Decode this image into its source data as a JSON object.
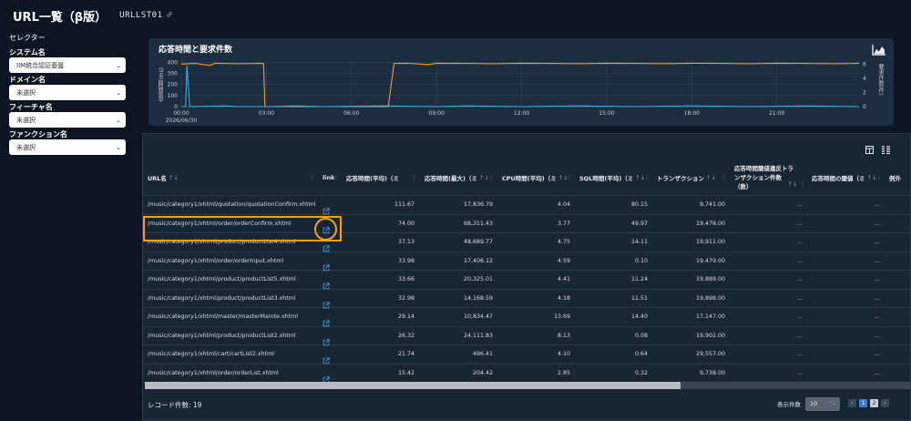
{
  "header": {
    "title": "URL一覧（β版）",
    "code": "URLLST01"
  },
  "sidebar": {
    "heading": "セレクター",
    "fields": [
      {
        "label": "システム名",
        "value": "IIM統合認証基盤"
      },
      {
        "label": "ドメイン名",
        "value": "未選択"
      },
      {
        "label": "フィーチャ名",
        "value": "未選択"
      },
      {
        "label": "ファンクション名",
        "value": "未選択"
      }
    ]
  },
  "chart": {
    "title": "応答時間と要求件数",
    "icon": "area-chart-icon",
    "y_left_title": "応答時間(ms)",
    "y_right_title": "要求件数(件)",
    "x_first_date": "2026/06/30"
  },
  "chart_data": {
    "type": "line",
    "x_ticks": [
      "00:00",
      "03:00",
      "06:00",
      "09:00",
      "12:00",
      "15:00",
      "18:00",
      "21:00"
    ],
    "y_left_ticks": [
      "0",
      "100",
      "200",
      "300",
      "400"
    ],
    "y_right_ticks": [
      "0",
      "2",
      "4",
      "6"
    ],
    "ylim_left": [
      0,
      420
    ],
    "ylim_right": [
      0,
      6.6
    ],
    "xlim_hours": [
      0,
      23.9
    ],
    "grid": true,
    "series": [
      {
        "color": "#f0a030",
        "axis": "left",
        "points": [
          [
            0,
            385
          ],
          [
            0.5,
            390
          ],
          [
            1,
            372
          ],
          [
            1.2,
            392
          ],
          [
            2,
            388
          ],
          [
            2.9,
            390
          ],
          [
            2.95,
            0
          ],
          [
            7.3,
            0
          ],
          [
            7.5,
            390
          ],
          [
            8,
            392
          ],
          [
            8.7,
            380
          ],
          [
            9,
            392
          ],
          [
            10,
            390
          ],
          [
            11,
            388
          ],
          [
            12,
            392
          ],
          [
            13,
            390
          ],
          [
            14,
            388
          ],
          [
            15,
            392
          ],
          [
            16,
            390
          ],
          [
            17,
            388
          ],
          [
            18,
            392
          ],
          [
            19,
            390
          ],
          [
            20,
            388
          ],
          [
            21,
            392
          ],
          [
            22,
            390
          ],
          [
            23,
            388
          ],
          [
            23.9,
            390
          ]
        ]
      },
      {
        "color": "#3fa8e0",
        "axis": "right",
        "points": [
          [
            0,
            0
          ],
          [
            0.15,
            0
          ],
          [
            0.2,
            5.8
          ],
          [
            0.3,
            0
          ],
          [
            1.5,
            0.1
          ],
          [
            2,
            0
          ],
          [
            3,
            0
          ],
          [
            4,
            0.1
          ],
          [
            5,
            0
          ],
          [
            7,
            0.1
          ],
          [
            9,
            0
          ],
          [
            10,
            0.1
          ],
          [
            12,
            0
          ],
          [
            14,
            0.1
          ],
          [
            16,
            0
          ],
          [
            18,
            0.1
          ],
          [
            20,
            0
          ],
          [
            22,
            0.1
          ],
          [
            23.9,
            0
          ]
        ]
      }
    ]
  },
  "table": {
    "columns": [
      "URL名",
      "link",
      "応答時間(平均)（ミ",
      "応答時間(最大)（ミ",
      "CPU時間(平均)（ミ",
      "SQL時間(平均)（ミ",
      "トランザクション",
      "応答時間閾値違反トランザクション件数（数）",
      "応答時間の閾値（ミ",
      "例外"
    ],
    "rows": [
      {
        "url": "/music/category1/xhtml/quotation/quotationConfirm.xhtml",
        "avg": "111.67",
        "max": "17,836.79",
        "cpu": "4.04",
        "sql": "80.15",
        "tx": "9,741.00",
        "viol": "...",
        "thr": "..."
      },
      {
        "url": "/music/category1/xhtml/order/orderConfirm.xhtml",
        "avg": "74.00",
        "max": "68,311.43",
        "cpu": "3.77",
        "sql": "49.97",
        "tx": "19,478.00",
        "viol": "...",
        "thr": "..."
      },
      {
        "url": "/music/category1/xhtml/product/productList4.xhtml",
        "avg": "37.13",
        "max": "48,689.77",
        "cpu": "4.75",
        "sql": "14.11",
        "tx": "19,911.00",
        "viol": "...",
        "thr": "..."
      },
      {
        "url": "/music/category1/xhtml/order/orderInput.xhtml",
        "avg": "33.98",
        "max": "17,406.12",
        "cpu": "4.59",
        "sql": "0.10",
        "tx": "19,479.00",
        "viol": "...",
        "thr": "..."
      },
      {
        "url": "/music/category1/xhtml/product/productList5.xhtml",
        "avg": "33.66",
        "max": "20,325.01",
        "cpu": "4.41",
        "sql": "11.24",
        "tx": "19,889.00",
        "viol": "...",
        "thr": "..."
      },
      {
        "url": "/music/category1/xhtml/product/productList3.xhtml",
        "avg": "32.98",
        "max": "14,168.59",
        "cpu": "4.18",
        "sql": "11.51",
        "tx": "19,898.00",
        "viol": "...",
        "thr": "..."
      },
      {
        "url": "/music/category1/xhtml/master/masterMainte.xhtml",
        "avg": "29.14",
        "max": "10,834.47",
        "cpu": "13.69",
        "sql": "14.40",
        "tx": "17,147.00",
        "viol": "...",
        "thr": "..."
      },
      {
        "url": "/music/category1/xhtml/product/productList2.xhtml",
        "avg": "26.32",
        "max": "24,111.83",
        "cpu": "8.13",
        "sql": "0.08",
        "tx": "19,902.00",
        "viol": "...",
        "thr": "..."
      },
      {
        "url": "/music/category1/xhtml/cart/cartList2.xhtml",
        "avg": "21.74",
        "max": "496.41",
        "cpu": "4.10",
        "sql": "0.64",
        "tx": "29,557.00",
        "viol": "...",
        "thr": "..."
      },
      {
        "url": "/music/category1/xhtml/order/orderList.xhtml",
        "avg": "15.42",
        "max": "204.42",
        "cpu": "2.85",
        "sql": "0.32",
        "tx": "9,738.00",
        "viol": "...",
        "thr": "..."
      }
    ],
    "scroll_position": 0.7
  },
  "footer": {
    "record_count": "レコード件数: 19",
    "per_page_label": "表示件数",
    "per_page_value": "10",
    "pages": [
      "1",
      "2"
    ],
    "current_page": "1"
  },
  "colors": {
    "accent": "#f0a30a",
    "line_response": "#f0a030",
    "line_requests": "#3fa8e0",
    "page_active": "#3c7fd0"
  }
}
